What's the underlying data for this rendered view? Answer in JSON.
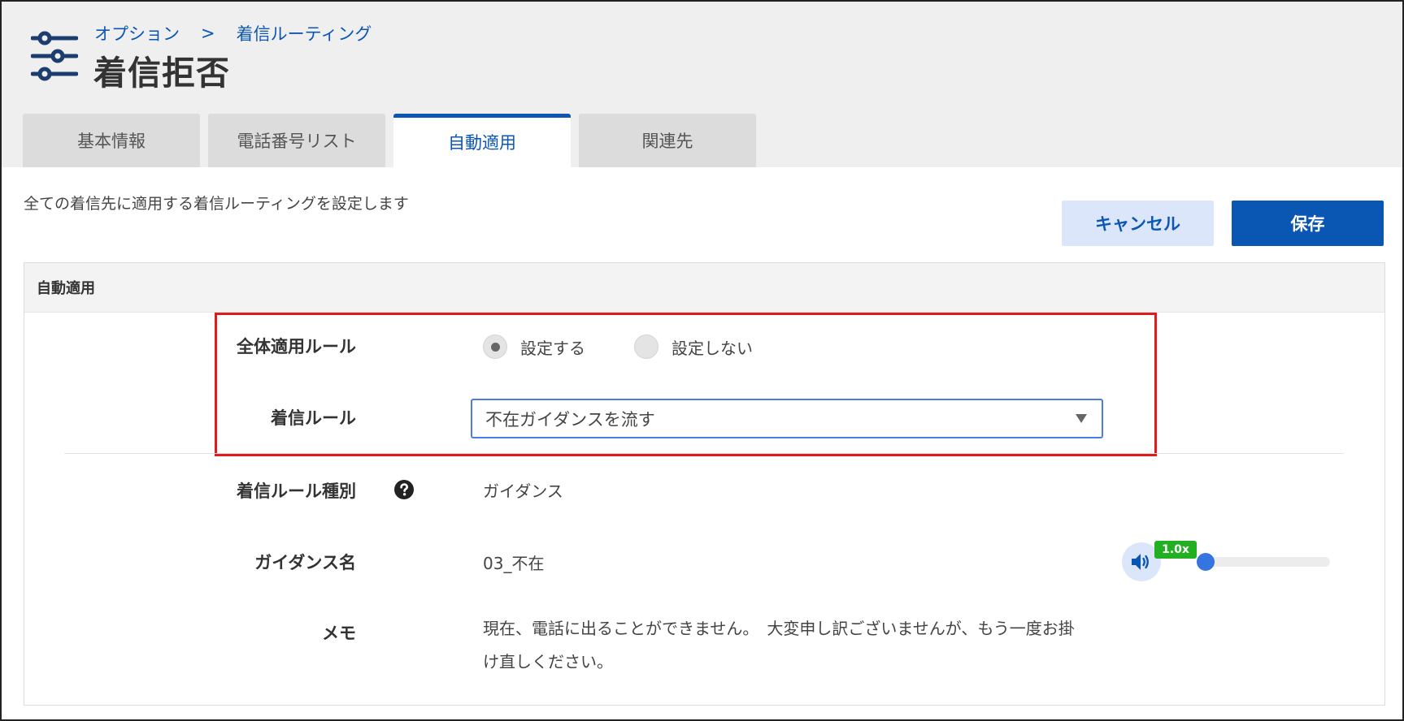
{
  "breadcrumb": {
    "parent": "オプション",
    "separator": ">",
    "current": "着信ルーティング"
  },
  "page": {
    "title": "着信拒否",
    "description": "全ての着信先に適用する着信ルーティングを設定します"
  },
  "tabs": [
    {
      "label": "基本情報",
      "active": false
    },
    {
      "label": "電話番号リスト",
      "active": false
    },
    {
      "label": "自動適用",
      "active": true
    },
    {
      "label": "関連先",
      "active": false
    }
  ],
  "actions": {
    "cancel_label": "キャンセル",
    "save_label": "保存"
  },
  "panel": {
    "title": "自動適用",
    "global_rule": {
      "label": "全体適用ルール",
      "options": [
        {
          "label": "設定する",
          "checked": true
        },
        {
          "label": "設定しない",
          "checked": false
        }
      ]
    },
    "incoming_rule": {
      "label": "着信ルール",
      "value": "不在ガイダンスを流す"
    },
    "rule_type": {
      "label": "着信ルール種別",
      "value": "ガイダンス"
    },
    "guidance_name": {
      "label": "ガイダンス名",
      "value": "03_不在"
    },
    "memo": {
      "label": "メモ",
      "value": "現在、電話に出ることができません。　大変申し訳ございませんが、もう一度お掛け直しください。"
    }
  },
  "player": {
    "speed": "1.0x",
    "progress": 0.0
  },
  "colors": {
    "accent": "#0a56b3",
    "highlight_border": "#e01b1b",
    "speed_badge": "#22b022"
  },
  "icons": [
    "settings-sliders-icon",
    "help-circle-icon",
    "dropdown-triangle-icon",
    "speaker-icon"
  ]
}
